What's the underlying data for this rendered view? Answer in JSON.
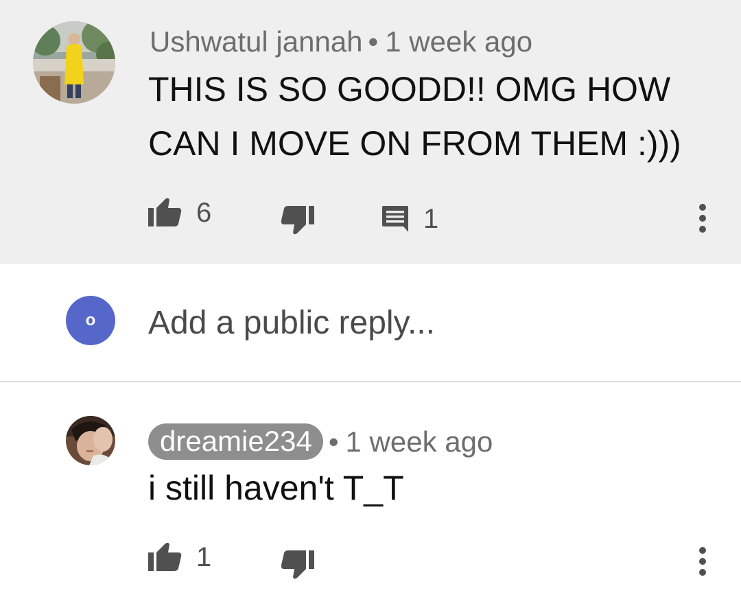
{
  "comments": [
    {
      "author": "Ushwatul jannah",
      "separator": "•",
      "time": "1 week ago",
      "text_lines": [
        "THIS IS SO GOODD!! OMG HOW",
        "CAN I MOVE ON FROM THEM :)))"
      ],
      "likes": "6",
      "replies": "1",
      "avatar_icon": "user-photo-avatar",
      "highlighted": true
    },
    {
      "author": "dreamie234",
      "author_is_creator_badge": true,
      "separator": "•",
      "time": "1 week ago",
      "text_lines": [
        "i still haven't T_T"
      ],
      "likes": "1",
      "avatar_icon": "user-photo-avatar"
    }
  ],
  "reply_box": {
    "user_initial": "o",
    "placeholder": "Add a public reply..."
  },
  "icons": {
    "like": "thumb-up-icon",
    "dislike": "thumb-down-icon",
    "reply": "comment-icon",
    "more": "more-vertical-icon"
  },
  "colors": {
    "highlight_background": "#efefef",
    "meta_text": "#6d6d6d",
    "author_badge": "#8e8e8e",
    "icon": "#505050",
    "user_avatar": "#5567c8",
    "divider": "#dcdcdc"
  }
}
